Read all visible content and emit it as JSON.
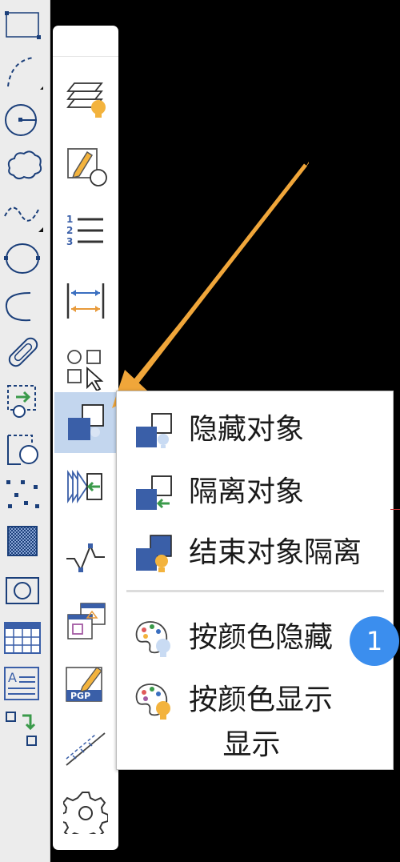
{
  "left_toolbar": {
    "tools": [
      {
        "icon": "rectangle-icon"
      },
      {
        "icon": "arc-icon"
      },
      {
        "icon": "circle-icon"
      },
      {
        "icon": "revision-cloud-icon"
      },
      {
        "icon": "spline-icon"
      },
      {
        "icon": "ellipse-icon"
      },
      {
        "icon": "ellipse-arc-icon"
      },
      {
        "icon": "donut-icon"
      },
      {
        "icon": "insert-block-icon"
      },
      {
        "icon": "create-block-icon"
      },
      {
        "icon": "point-icon"
      },
      {
        "icon": "hatch-icon"
      },
      {
        "icon": "region-icon"
      },
      {
        "icon": "table-icon"
      },
      {
        "icon": "multiline-text-icon"
      },
      {
        "icon": "move-block-icon"
      }
    ]
  },
  "float_toolbar": {
    "tools": [
      {
        "icon": "layer-properties-icon"
      },
      {
        "icon": "edit-attribute-icon"
      },
      {
        "icon": "numbered-list-icon"
      },
      {
        "icon": "dimension-icon"
      },
      {
        "icon": "quick-select-icon"
      },
      {
        "icon": "hide-objects-icon",
        "active": true
      },
      {
        "icon": "isolate-import-icon"
      },
      {
        "icon": "polyline-edit-icon"
      },
      {
        "icon": "xref-overlay-icon"
      },
      {
        "icon": "pgp-edit-icon"
      },
      {
        "icon": "measure-ruler-icon"
      },
      {
        "icon": "settings-gear-icon"
      }
    ]
  },
  "flyout_menu": {
    "items": [
      {
        "label": "隐藏对象",
        "icon": "hide-objects-icon"
      },
      {
        "label": "隔离对象",
        "icon": "isolate-objects-icon"
      },
      {
        "label": "结束对象隔离",
        "icon": "end-isolation-icon"
      },
      {
        "label": "按颜色隐藏",
        "icon": "hide-by-color-icon"
      },
      {
        "label": "按颜色显示",
        "icon": "show-by-color-icon"
      }
    ],
    "footer_label": "显示"
  },
  "badge": {
    "text": "1",
    "color": "#3b8eee"
  },
  "colors": {
    "accent_blue": "#3a5fa8",
    "bulb": "#f3b33d",
    "arrow": "#f0a63a",
    "active_bg": "#c3d6ee"
  }
}
